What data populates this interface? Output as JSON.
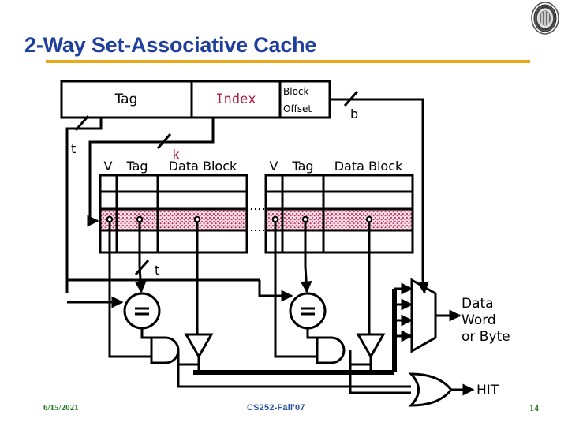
{
  "slide": {
    "title": "2-Way Set-Associative Cache",
    "accent_color": "#e8aa1c",
    "title_color": "#1f3f9e",
    "highlight_color": "#c0305a",
    "red_label_color": "#b01c3c"
  },
  "logo": {
    "name": "university-seal-logo"
  },
  "address": {
    "fields": [
      {
        "label": "Tag"
      },
      {
        "label": "Index"
      },
      {
        "label": "Block Offset",
        "line1": "Block",
        "line2": "Offset"
      }
    ],
    "bit_widths": [
      {
        "label": "t",
        "color": "black"
      },
      {
        "label": "k",
        "color": "red"
      },
      {
        "label": "b",
        "color": "black"
      }
    ]
  },
  "cache": {
    "ways": [
      {
        "name": "way-0",
        "columns": [
          "V",
          "Tag",
          "Data Block"
        ],
        "rows": 4,
        "selected_row_index": 2
      },
      {
        "name": "way-1",
        "columns": [
          "V",
          "Tag",
          "Data Block"
        ],
        "rows": 4,
        "selected_row_index": 2
      }
    ]
  },
  "logic": {
    "comparator_symbol": "=",
    "tag_compare_width_label": "t",
    "mux_inputs": 4,
    "output_label_lines": [
      "Data",
      "Word",
      "or Byte"
    ],
    "hit_label": "HIT"
  },
  "footer": {
    "date": "6/15/2021",
    "course": "CS252-Fall'07",
    "page": "14"
  }
}
